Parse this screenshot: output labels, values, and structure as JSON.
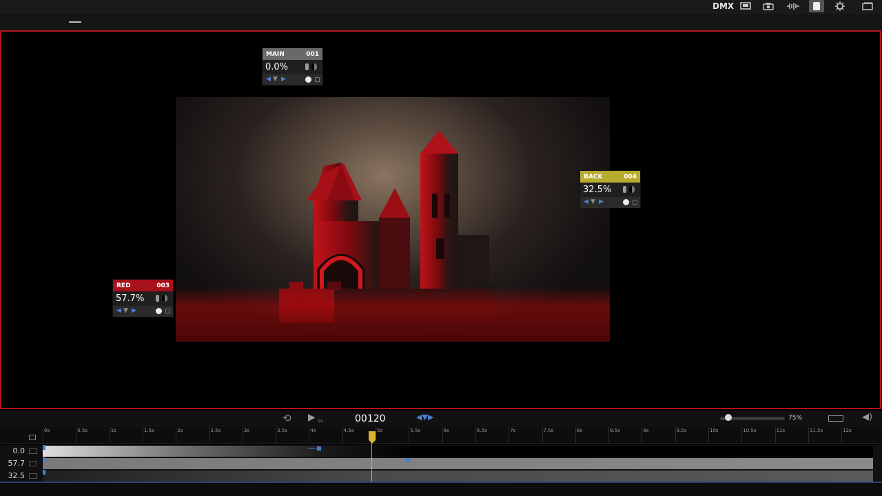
{
  "topbar": {
    "dmx_label": "DMX",
    "icons": [
      "monitor-icon",
      "camera-icon",
      "waveform-icon",
      "spotlight-icon",
      "settings-icon",
      "window-icon"
    ]
  },
  "cards": [
    {
      "id": "main",
      "name": "MAIN",
      "number": "001",
      "value": "0.0%",
      "color": "#6a6a6a"
    },
    {
      "id": "back",
      "name": "BACK",
      "number": "004",
      "value": "32.5%",
      "color": "#b8ac2e"
    },
    {
      "id": "red",
      "name": "RED",
      "number": "003",
      "value": "57.7%",
      "color": "#a8101a"
    }
  ],
  "transport": {
    "rate": "1x",
    "frame": "00120",
    "zoom": "75%",
    "zoom_level": 0.1
  },
  "ruler": {
    "labels": [
      "0s",
      "0.5s",
      "1s",
      "1.5s",
      "2s",
      "2.5s",
      "3s",
      "3.5s",
      "4s",
      "4.5s",
      "5s",
      "5.5s",
      "6s",
      "6.5s",
      "7s",
      "7.5s",
      "8s",
      "8.5s",
      "9s",
      "9.5s",
      "10s",
      "10.5s",
      "11s",
      "11.5s",
      "12s"
    ]
  },
  "tracks": [
    {
      "value": "0.0"
    },
    {
      "value": "57.7"
    },
    {
      "value": "32.5"
    }
  ],
  "colors": {
    "accent_red": "#b0141c",
    "keyframe_blue": "#4a7fd0",
    "playhead_yellow": "#d8b52a"
  }
}
